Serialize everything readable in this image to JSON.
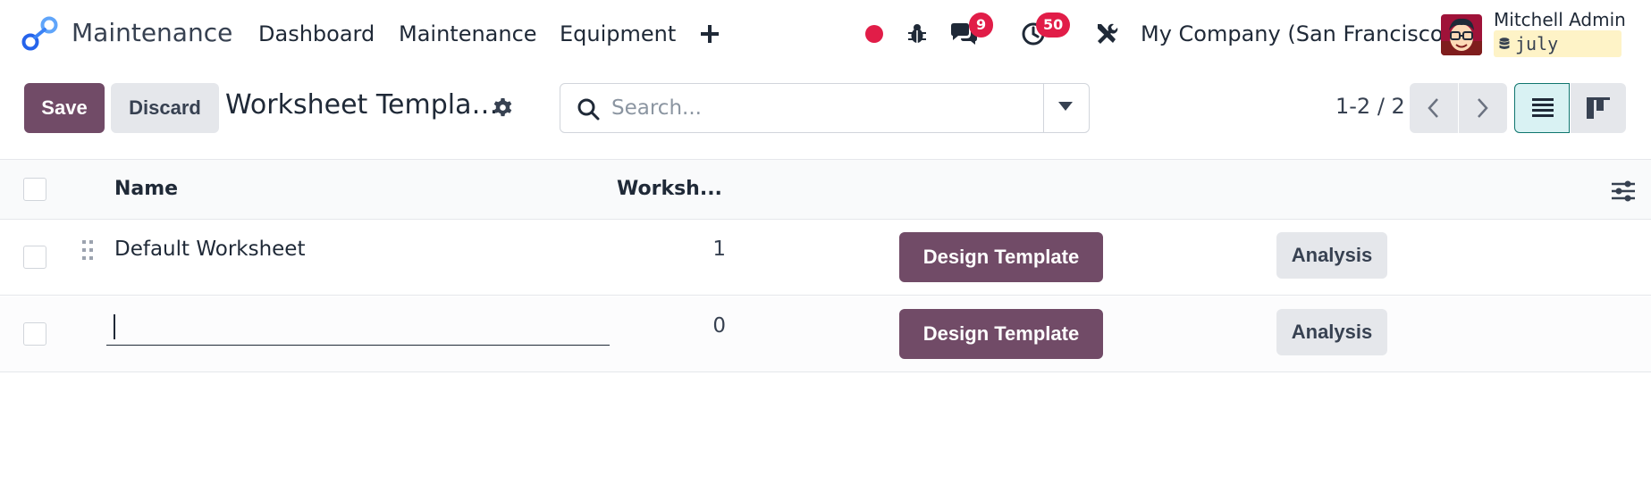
{
  "navbar": {
    "app_name": "Maintenance",
    "menu": [
      {
        "label": "Dashboard"
      },
      {
        "label": "Maintenance"
      },
      {
        "label": "Equipment"
      }
    ],
    "add_icon": "plus-icon",
    "messages_count": "9",
    "activities_count": "50",
    "company": "My Company (San Francisco)",
    "user_name": "Mitchell Admin",
    "database": "july"
  },
  "control_panel": {
    "save_label": "Save",
    "discard_label": "Discard",
    "breadcrumb": "Worksheet Templa…",
    "search_placeholder": "Search...",
    "pager": "1-2 / 2"
  },
  "list": {
    "columns": [
      {
        "label": "Name"
      },
      {
        "label": "Worksh..."
      }
    ],
    "rows": [
      {
        "name": "Default Worksheet",
        "count": "1",
        "design_label": "Design Template",
        "analysis_label": "Analysis"
      },
      {
        "name": "",
        "count": "0",
        "design_label": "Design Template",
        "analysis_label": "Analysis"
      }
    ]
  },
  "colors": {
    "primary": "#714b67",
    "badge": "#e11d48",
    "status_dot": "#e11d48",
    "logo_blue": "#2563eb"
  }
}
